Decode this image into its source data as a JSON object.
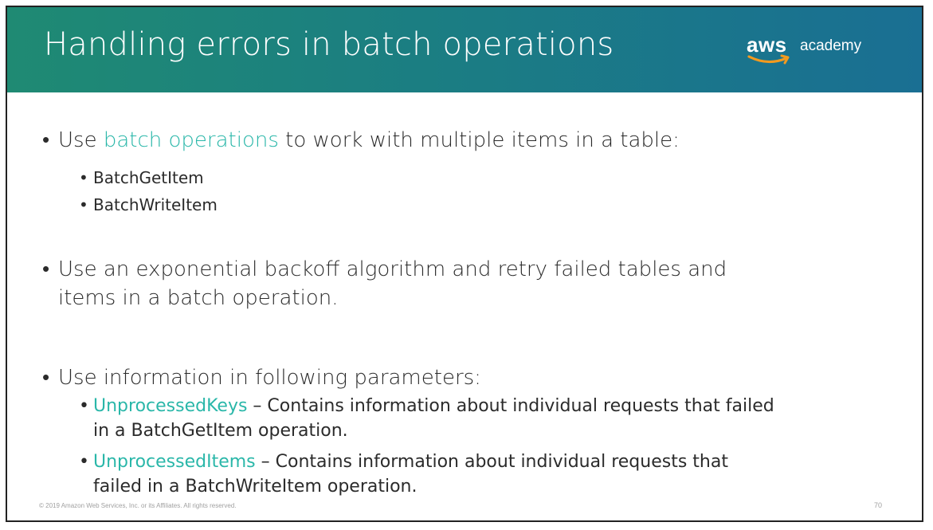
{
  "slide": {
    "title": "Handling errors in batch operations",
    "logo": {
      "wordmark": "aws",
      "suffix": "academy"
    },
    "bullets": {
      "b1": {
        "prefix": "Use ",
        "highlight": "batch operations",
        "suffix": " to work with multiple items in a table:",
        "sub": [
          "BatchGetItem",
          "BatchWriteItem"
        ]
      },
      "b2": {
        "line1": "Use an exponential backoff algorithm and retry failed tables and",
        "line2": "items in a batch operation."
      },
      "b3": {
        "text": "Use information in following parameters:",
        "sub1": {
          "highlight": "UnprocessedKeys",
          "line1": " – Contains information about individual requests that failed",
          "line2": "in a BatchGetItem operation."
        },
        "sub2": {
          "highlight": "UnprocessedItems",
          "line1": " – Contains information about individual requests that",
          "line2": "failed in a BatchWriteItem operation."
        }
      }
    },
    "footer": {
      "copyright": "© 2019 Amazon Web Services, Inc. or its Affiliates. All rights reserved.",
      "page_number": "70"
    },
    "colors": {
      "header_start": "#1f8a73",
      "header_end": "#1a6f93",
      "accent": "#2ab7a9",
      "logo_smile": "#f29a1f"
    }
  }
}
